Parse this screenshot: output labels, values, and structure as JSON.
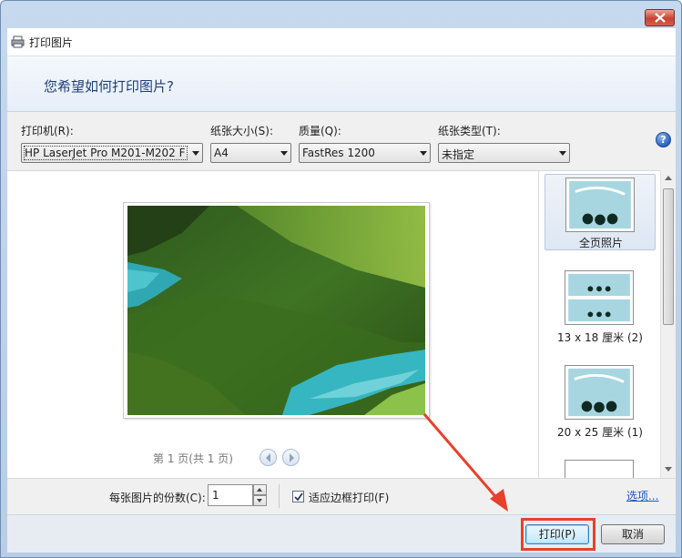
{
  "window": {
    "title": "打印图片",
    "close_icon": "close-icon",
    "print_icon": "printer-icon"
  },
  "header": {
    "question": "您希望如何打印图片?"
  },
  "options": {
    "printer": {
      "label": "打印机(R):",
      "value": "HP LaserJet Pro M201-M202 F"
    },
    "paper_size": {
      "label": "纸张大小(S):",
      "value": "A4"
    },
    "quality": {
      "label": "质量(Q):",
      "value": "FastRes 1200"
    },
    "paper_type": {
      "label": "纸张类型(T):",
      "value": "未指定"
    },
    "help": "?"
  },
  "preview": {
    "page_info": "第 1 页(共 1 页)",
    "prev_icon": "arrow-left-icon",
    "next_icon": "arrow-right-icon"
  },
  "layouts": {
    "items": [
      {
        "label": "全页照片",
        "selected": true
      },
      {
        "label": "13 x 18 厘米 (2)",
        "selected": false
      },
      {
        "label": "20 x 25 厘米 (1)",
        "selected": false
      }
    ]
  },
  "bottom": {
    "copies_label": "每张图片的份数(C):",
    "copies_value": "1",
    "fit_label": "适应边框打印(F)",
    "fit_checked": true,
    "options_link": "选项..."
  },
  "footer": {
    "print_button": "打印(P)",
    "cancel_button": "取消"
  },
  "colors": {
    "annotation_red": "#e8402d",
    "link_blue": "#1a57c4"
  }
}
